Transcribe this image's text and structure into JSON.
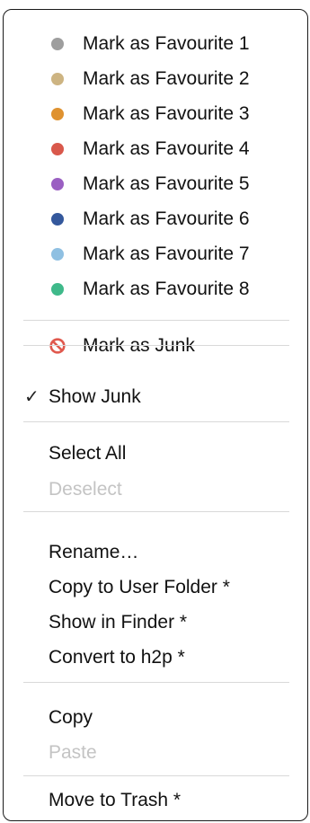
{
  "favourites": [
    {
      "label": "Mark as Favourite 1",
      "color": "#9e9e9e"
    },
    {
      "label": "Mark as Favourite 2",
      "color": "#cdb482"
    },
    {
      "label": "Mark as Favourite 3",
      "color": "#df9230"
    },
    {
      "label": "Mark as Favourite 4",
      "color": "#d9584b"
    },
    {
      "label": "Mark as Favourite 5",
      "color": "#9a5fc2"
    },
    {
      "label": "Mark as Favourite 6",
      "color": "#34589c"
    },
    {
      "label": "Mark as Favourite 7",
      "color": "#8fc0e2"
    },
    {
      "label": "Mark as Favourite 8",
      "color": "#3fb98a"
    }
  ],
  "junk": {
    "mark_label": "Mark as Junk",
    "icon": "prohibited-icon",
    "icon_color": "#e0594e",
    "show_label": "Show Junk",
    "show_checked": true,
    "checkmark": "✓"
  },
  "selection": {
    "select_all": "Select All",
    "deselect": "Deselect",
    "deselect_enabled": false
  },
  "file_actions": {
    "rename": "Rename…",
    "copy_to_user_folder": "Copy to User Folder *",
    "show_in_finder": "Show in Finder *",
    "convert_to_h2p": "Convert to h2p *"
  },
  "clipboard": {
    "copy": "Copy",
    "paste": "Paste",
    "paste_enabled": false
  },
  "trash": {
    "move_to_trash": "Move to Trash *"
  }
}
